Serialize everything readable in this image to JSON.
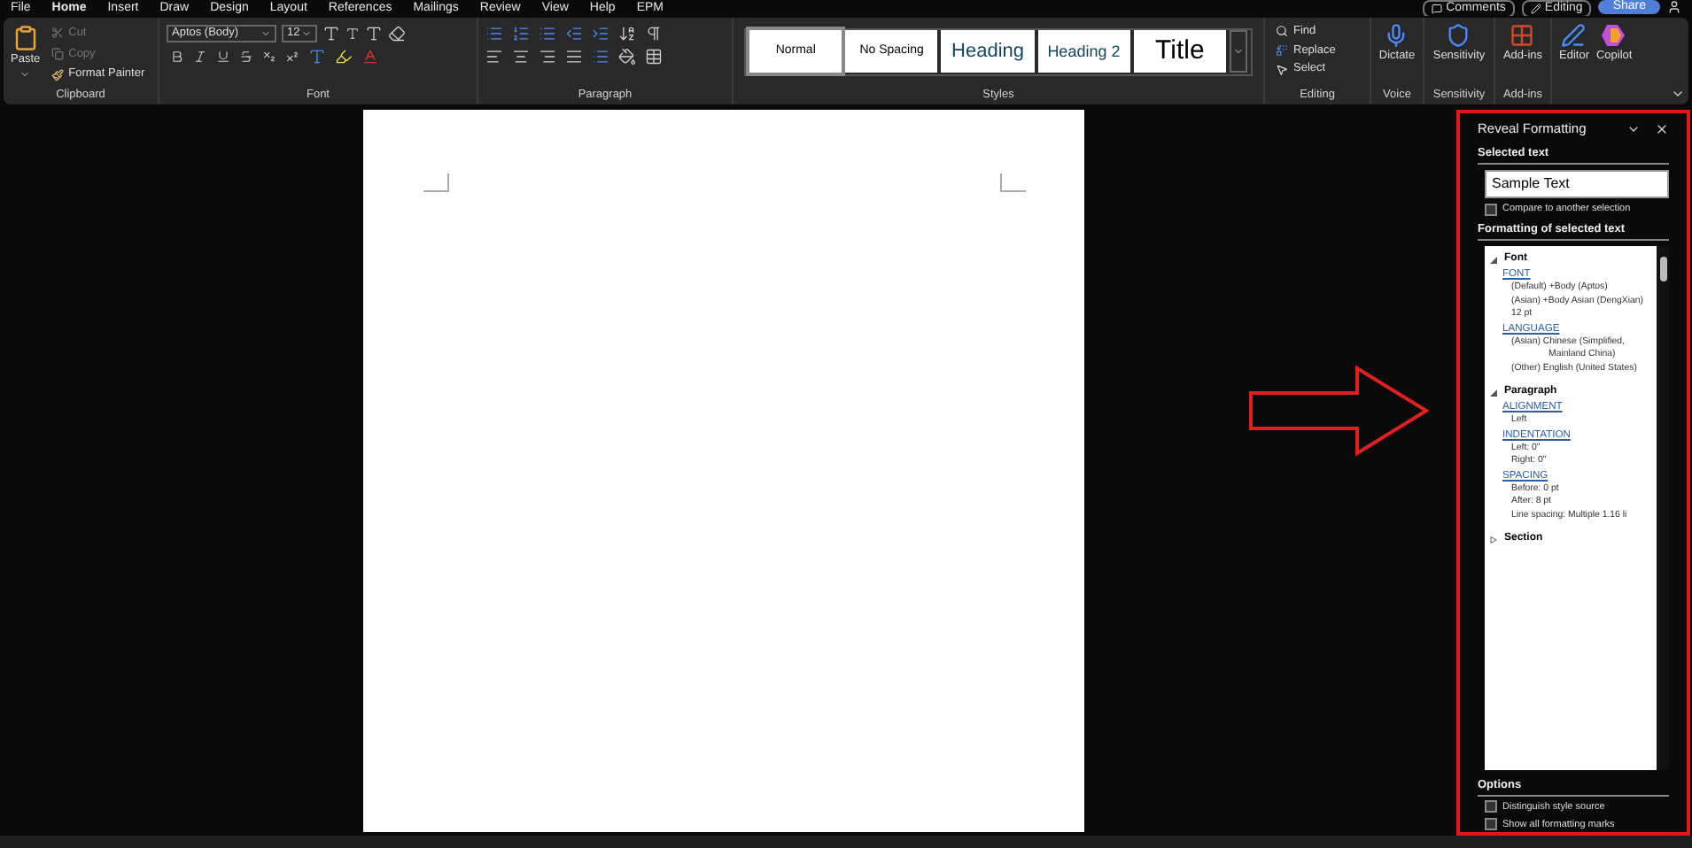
{
  "menu_tabs": [
    {
      "label": "File",
      "selected": false
    },
    {
      "label": "Home",
      "selected": true
    },
    {
      "label": "Insert",
      "selected": false
    },
    {
      "label": "Draw",
      "selected": false
    },
    {
      "label": "Design",
      "selected": false
    },
    {
      "label": "Layout",
      "selected": false
    },
    {
      "label": "References",
      "selected": false
    },
    {
      "label": "Mailings",
      "selected": false
    },
    {
      "label": "Review",
      "selected": false
    },
    {
      "label": "View",
      "selected": false
    },
    {
      "label": "Help",
      "selected": false
    },
    {
      "label": "EPM",
      "selected": false
    }
  ],
  "title_actions": {
    "comments": "Comments",
    "editing": "Editing",
    "share": "Share"
  },
  "clipboard": {
    "paste": "Paste",
    "cut": "Cut",
    "copy": "Copy",
    "format_painter": "Format Painter",
    "label": "Clipboard"
  },
  "font": {
    "name": "Aptos (Body)",
    "size": "12",
    "label": "Font"
  },
  "paragraph": {
    "label": "Paragraph"
  },
  "styles": {
    "items": [
      {
        "label": "Normal",
        "selected": true,
        "kind": "normal"
      },
      {
        "label": "No Spacing",
        "selected": false,
        "kind": "normal"
      },
      {
        "label": "Heading",
        "selected": false,
        "kind": "heading1"
      },
      {
        "label": "Heading 2",
        "selected": false,
        "kind": "heading2"
      },
      {
        "label": "Title",
        "selected": false,
        "kind": "title"
      }
    ],
    "label": "Styles"
  },
  "editing": {
    "find": "Find",
    "replace": "Replace",
    "select": "Select",
    "label": "Editing"
  },
  "voice": {
    "dictate": "Dictate",
    "label": "Voice"
  },
  "sensitivity": {
    "button": "Sensitivity",
    "label": "Sensitivity"
  },
  "addins": {
    "button": "Add-ins",
    "label": "Add-ins"
  },
  "extras": {
    "editor": "Editor",
    "copilot": "Copilot"
  },
  "panel": {
    "title": "Reveal Formatting",
    "selected_text_label": "Selected text",
    "selected_text": "Sample Text",
    "compare": {
      "label": "Compare to another selection",
      "checked": false
    },
    "formatting_label": "Formatting of selected text",
    "tree": [
      {
        "label": "Font",
        "expanded": true,
        "children": [
          {
            "link": "FONT",
            "lines": [
              {
                "text": "(Default) +Body (Aptos)",
                "kind": "line"
              },
              {
                "text": "(Asian) +Body Asian (DengXian)",
                "kind": "line"
              },
              {
                "text": "12 pt",
                "kind": "line"
              }
            ]
          },
          {
            "link": "LANGUAGE",
            "lines": [
              {
                "text": "(Asian) Chinese (Simplified,",
                "kind": "line"
              },
              {
                "text": "Mainland China)",
                "kind": "continuation"
              },
              {
                "text": "(Other) English (United States)",
                "kind": "line"
              }
            ]
          }
        ]
      },
      {
        "label": "Paragraph",
        "expanded": true,
        "children": [
          {
            "link": "ALIGNMENT",
            "lines": [
              {
                "text": "Left",
                "kind": "line"
              }
            ]
          },
          {
            "link": "INDENTATION",
            "lines": [
              {
                "text": "Left:  0\"",
                "kind": "line"
              },
              {
                "text": "Right:  0\"",
                "kind": "line"
              }
            ]
          },
          {
            "link": "SPACING",
            "lines": [
              {
                "text": "Before:  0 pt",
                "kind": "line"
              },
              {
                "text": "After:  8 pt",
                "kind": "line"
              },
              {
                "text": "Line spacing:  Multiple 1.16 li",
                "kind": "line"
              }
            ]
          }
        ]
      },
      {
        "label": "Section",
        "expanded": false
      }
    ],
    "options_label": "Options",
    "options": [
      {
        "label": "Distinguish style source",
        "checked": false
      },
      {
        "label": "Show all formatting marks",
        "checked": false
      }
    ]
  }
}
